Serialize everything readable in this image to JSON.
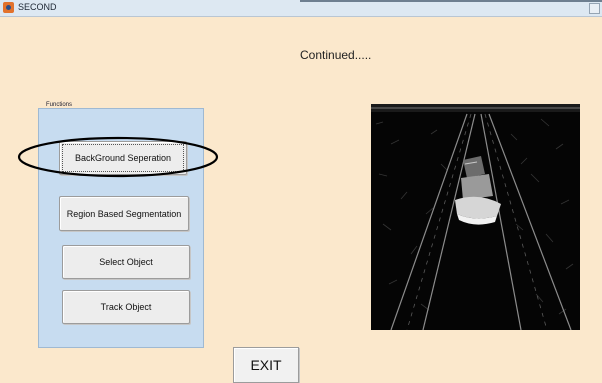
{
  "window": {
    "title": "SECOND",
    "icon": "matlab-icon"
  },
  "header": {
    "continued_text": "Continued....."
  },
  "functions_panel": {
    "legend": "Functions",
    "buttons": [
      {
        "label": "BackGround Seperation",
        "highlighted": true
      },
      {
        "label": "Region Based Segmentation"
      },
      {
        "label": "Select  Object"
      },
      {
        "label": "Track  Object"
      }
    ]
  },
  "exit_button": {
    "label": "EXIT"
  },
  "display": {
    "content": "segmented-road-image"
  },
  "colors": {
    "background": "#fbe8cc",
    "panel": "#c7dcf0",
    "button": "#ededed",
    "image_bg": "#050505"
  }
}
